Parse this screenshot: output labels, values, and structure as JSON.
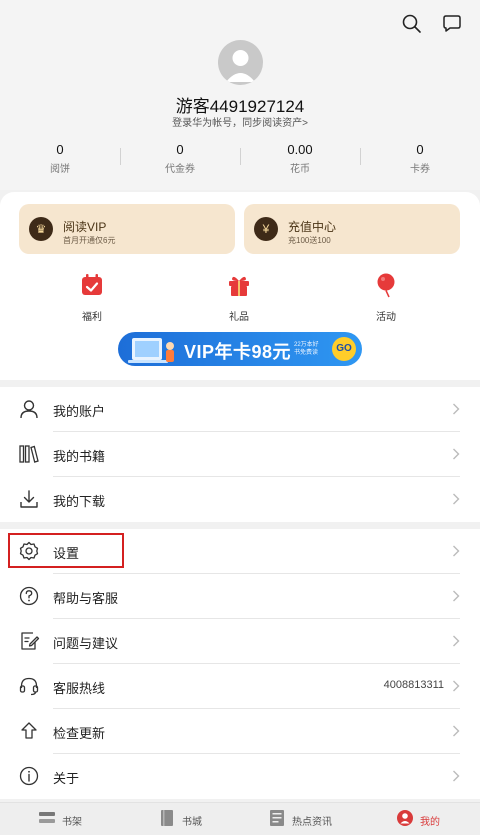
{
  "profile": {
    "username": "游客4491927124",
    "login_hint": "登录华为帐号，同步阅读资产>"
  },
  "stats": [
    {
      "value": "0",
      "label": "阅饼"
    },
    {
      "value": "0",
      "label": "代金券"
    },
    {
      "value": "0.00",
      "label": "花币"
    },
    {
      "value": "0",
      "label": "卡券"
    }
  ],
  "promos": {
    "vip": {
      "title": "阅读VIP",
      "subtitle": "首月开通仅6元"
    },
    "recharge": {
      "title": "充值中心",
      "subtitle": "充100送100"
    }
  },
  "quick_links": [
    {
      "label": "福利",
      "icon": "calendar-check-icon"
    },
    {
      "label": "礼品",
      "icon": "gift-icon"
    },
    {
      "label": "活动",
      "icon": "balloon-icon"
    }
  ],
  "banner": {
    "text": "VIP年卡98元",
    "small_line1": "22万本好",
    "small_line2": "书免费读",
    "go": "GO"
  },
  "menu_group1": [
    {
      "label": "我的账户",
      "icon": "person-icon"
    },
    {
      "label": "我的书籍",
      "icon": "books-icon"
    },
    {
      "label": "我的下载",
      "icon": "download-icon"
    }
  ],
  "menu_group2": [
    {
      "label": "设置",
      "icon": "gear-icon"
    },
    {
      "label": "帮助与客服",
      "icon": "help-icon"
    },
    {
      "label": "问题与建议",
      "icon": "feedback-icon"
    },
    {
      "label": "客服热线",
      "icon": "headset-icon",
      "value": "4008813311"
    },
    {
      "label": "检查更新",
      "icon": "upload-arrow-icon"
    },
    {
      "label": "关于",
      "icon": "info-icon"
    }
  ],
  "tabs": [
    {
      "label": "书架",
      "icon": "bookshelf-icon",
      "active": false
    },
    {
      "label": "书城",
      "icon": "bookstore-icon",
      "active": false
    },
    {
      "label": "热点资讯",
      "icon": "news-icon",
      "active": false
    },
    {
      "label": "我的",
      "icon": "profile-icon",
      "active": true
    }
  ],
  "colors": {
    "accent": "#d93b3b",
    "promo_bg": "#f6e6cf",
    "banner_blue": "#2f97f2",
    "highlight_box": "#d42020"
  }
}
